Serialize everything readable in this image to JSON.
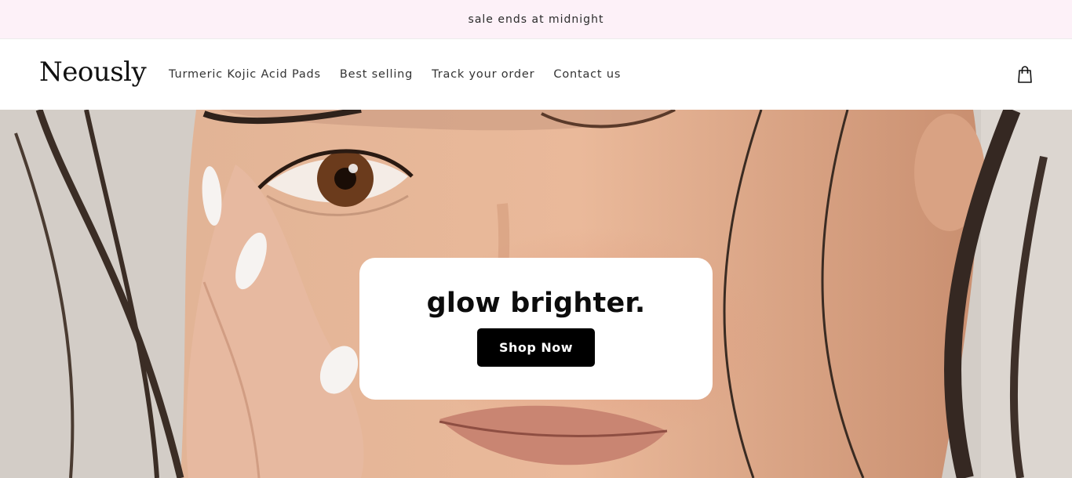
{
  "announcement": {
    "text": "sale ends at midnight",
    "background": "#fdf1f8"
  },
  "header": {
    "logo": "Neously",
    "nav": [
      {
        "label": "Turmeric Kojic Acid Pads"
      },
      {
        "label": "Best selling"
      },
      {
        "label": "Track your order"
      },
      {
        "label": "Contact us"
      }
    ],
    "cart_icon": "shopping-bag-icon"
  },
  "hero": {
    "image": "hero-photo-woman-closeup",
    "heading": "glow brighter.",
    "button_label": "Shop Now",
    "button_color": "#000000"
  }
}
